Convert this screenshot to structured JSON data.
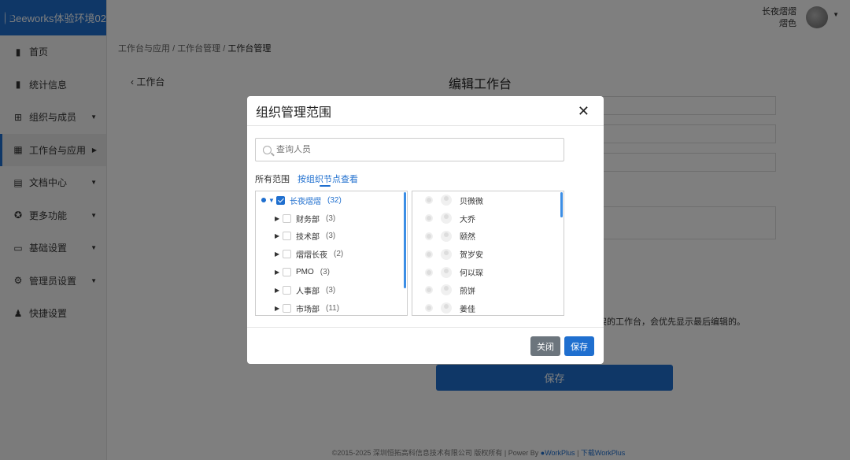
{
  "brand": {
    "title": "Beeworks体验环境02"
  },
  "sidebar": {
    "items": [
      {
        "label": "首页",
        "icon": "bar-chart-icon",
        "caret": ""
      },
      {
        "label": "统计信息",
        "icon": "bar-chart-icon",
        "caret": ""
      },
      {
        "label": "组织与成员",
        "icon": "sitemap-icon",
        "caret": "▼"
      },
      {
        "label": "工作台与应用",
        "icon": "grid-icon",
        "caret": "▶"
      },
      {
        "label": "文档中心",
        "icon": "document-icon",
        "caret": "▼"
      },
      {
        "label": "更多功能",
        "icon": "medal-icon",
        "caret": "▼"
      },
      {
        "label": "基础设置",
        "icon": "laptop-icon",
        "caret": "▼"
      },
      {
        "label": "管理员设置",
        "icon": "user-gear-icon",
        "caret": "▼"
      },
      {
        "label": "快捷设置",
        "icon": "user-lock-icon",
        "caret": ""
      }
    ],
    "active_index": 3
  },
  "header": {
    "user_name": "长夜熠熠",
    "user_sub": "熠色"
  },
  "breadcrumb": {
    "first": "工作台与应用",
    "sep": "/",
    "second": "工作台管理",
    "current": "工作台管理"
  },
  "page": {
    "back_label": "工作台",
    "title": "编辑工作台",
    "hint": "架的工作台，会优先显示最后编辑的。",
    "save_label": "保存"
  },
  "footer": {
    "copyright": "©2015-2025 深圳恒拓高科信息技术有限公司 版权所有 | Power By",
    "powered": "WorkPlus",
    "sep": "|",
    "download": "下载WorkPlus"
  },
  "modal": {
    "title": "组织管理范围",
    "close_glyph": "✕",
    "search_placeholder": "查询人员",
    "tabs": [
      "所有范围",
      "按组织节点查看"
    ],
    "root": {
      "name": "长夜熠熠",
      "count": "(32)"
    },
    "departments": [
      {
        "name": "财务部",
        "count": "(3)"
      },
      {
        "name": "技术部",
        "count": "(3)"
      },
      {
        "name": "熠熠长夜",
        "count": "(2)"
      },
      {
        "name": "PMO",
        "count": "(3)"
      },
      {
        "name": "人事部",
        "count": "(3)"
      },
      {
        "name": "市场部",
        "count": "(11)"
      }
    ],
    "members": [
      "贝微微",
      "大乔",
      "颐然",
      "贺岁安",
      "何以琛",
      "煎饼",
      "姜佳"
    ],
    "close_label": "关闭",
    "save_label": "保存"
  }
}
